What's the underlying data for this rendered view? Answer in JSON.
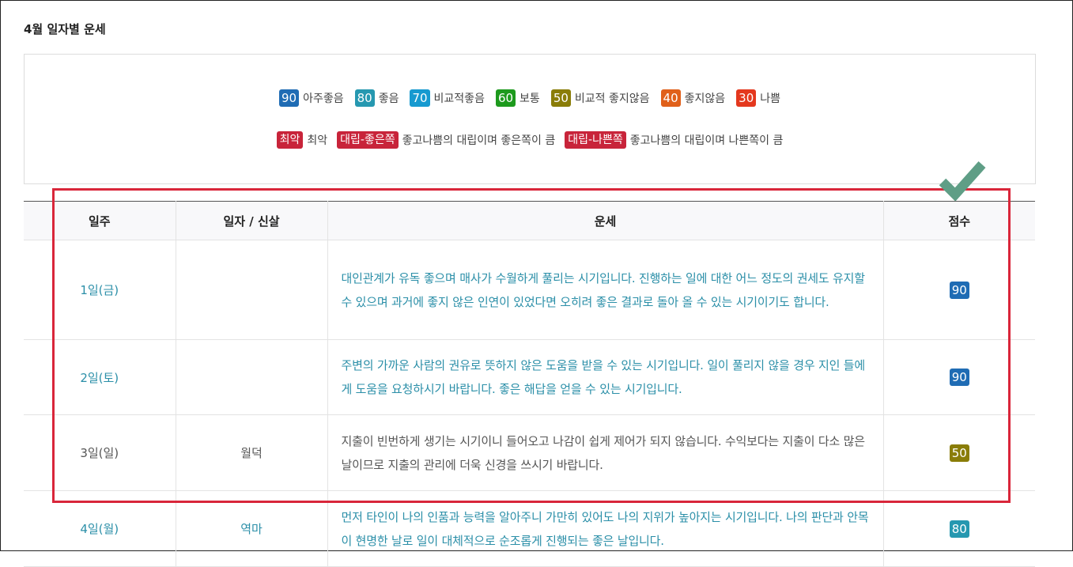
{
  "page": {
    "title": "4월 일자별 운세"
  },
  "legend": {
    "scores": [
      {
        "badge": "90",
        "label": "아주좋음",
        "color": "#1f6cb4"
      },
      {
        "badge": "80",
        "label": "좋음",
        "color": "#2698b0"
      },
      {
        "badge": "70",
        "label": "비교적좋음",
        "color": "#179ad0"
      },
      {
        "badge": "60",
        "label": "보통",
        "color": "#1d9a1d"
      },
      {
        "badge": "50",
        "label": "비교적 좋지않음",
        "color": "#8a7d08"
      },
      {
        "badge": "40",
        "label": "좋지않음",
        "color": "#e0601a"
      },
      {
        "badge": "30",
        "label": "나쁨",
        "color": "#e4381e"
      }
    ],
    "special": [
      {
        "badge": "최악",
        "label": "최악",
        "color": "#c8243a"
      },
      {
        "badge": "대립-좋은쪽",
        "label": "좋고나쁨의 대립이며 좋은쪽이 큼",
        "color": "#c8243a"
      },
      {
        "badge": "대립-나쁜쪽",
        "label": "좋고나쁨의 대립이며 나쁜쪽이 큼",
        "color": "#c8243a"
      }
    ]
  },
  "table": {
    "headers": {
      "day": "일주",
      "date": "일자 / 신살",
      "fortune": "운세",
      "score": "점수"
    },
    "rows": [
      {
        "day": "1일(금)",
        "date": "",
        "fortune": "대인관계가 유독 좋으며 매사가 수월하게 풀리는 시기입니다. 진행하는 일에 대한 어느 정도의 권세도 유지할 수 있으며 과거에 좋지 않은 인연이 있었다면 오히려 좋은 결과로 돌아 올 수 있는 시기이기도 합니다.",
        "score": "90",
        "score_color": "#1f6cb4"
      },
      {
        "day": "2일(토)",
        "date": "",
        "fortune": "주변의 가까운 사람의 권유로 뜻하지 않은 도움을 받을 수 있는 시기입니다. 일이 풀리지 않을 경우 지인 들에게 도움을 요청하시기 바랍니다. 좋은 해답을 얻을 수 있는 시기입니다.",
        "score": "90",
        "score_color": "#1f6cb4"
      },
      {
        "day": "3일(일)",
        "date": "월덕",
        "fortune": "지출이 빈번하게 생기는 시기이니 들어오고 나감이 쉽게 제어가 되지 않습니다. 수익보다는 지출이 다소 많은 날이므로 지출의 관리에 더욱 신경을 쓰시기 바랍니다.",
        "score": "50",
        "score_color": "#8a7d08"
      },
      {
        "day": "4일(월)",
        "date": "역마",
        "fortune": "먼저 타인이 나의 인품과 능력을 알아주니 가만히 있어도 나의 지위가 높아지는 시기입니다. 나의 판단과 안목이 현명한 날로 일이 대체적으로 순조롭게 진행되는 좋은 날입니다.",
        "score": "80",
        "score_color": "#2698b0"
      }
    ]
  },
  "annotation": {
    "highlight_color": "#d9263a",
    "check_color": "#5f9e86",
    "check_icon": "checkmark-icon"
  }
}
